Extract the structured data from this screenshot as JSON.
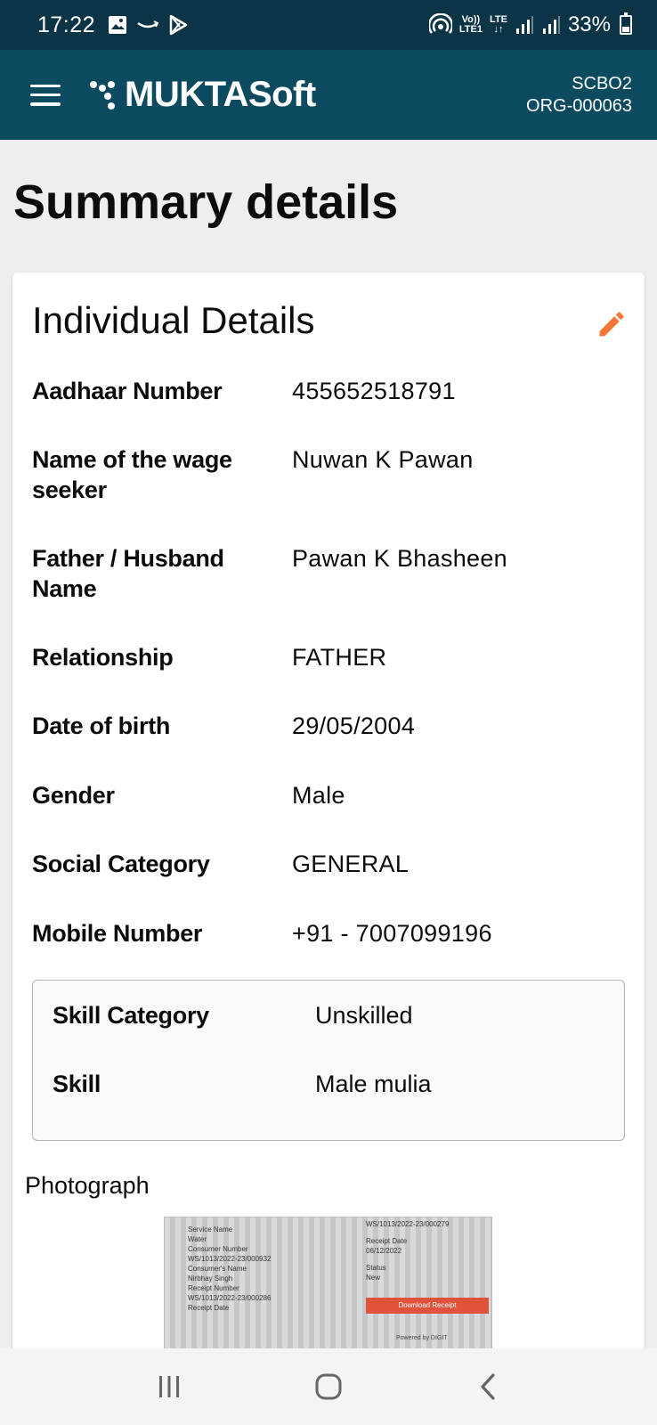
{
  "status_bar": {
    "time": "17:22",
    "battery": "33%",
    "volte": "Vo))",
    "lte1": "LTE1",
    "lte": "LTE",
    "icons": [
      "gallery-icon",
      "amazon-icon",
      "play-store-icon",
      "hotspot-icon",
      "signal-icon",
      "signal-icon",
      "battery-icon"
    ]
  },
  "header": {
    "brand": "MUKTASoft",
    "org_code": "SCBO2",
    "org_id": "ORG-000063",
    "colors": {
      "bar": "#0c4a60",
      "status": "#0c3447"
    }
  },
  "page": {
    "title": "Summary details"
  },
  "card": {
    "title": "Individual Details",
    "edit_color": "#f47738",
    "rows": [
      {
        "label": "Aadhaar Number",
        "value": "455652518791"
      },
      {
        "label": "Name of the wage seeker",
        "value": "Nuwan K Pawan"
      },
      {
        "label": "Father / Husband Name",
        "value": "Pawan K Bhasheen"
      },
      {
        "label": "Relationship",
        "value": "FATHER"
      },
      {
        "label": "Date of birth",
        "value": "29/05/2004"
      },
      {
        "label": "Gender",
        "value": "Male"
      },
      {
        "label": "Social Category",
        "value": "GENERAL"
      },
      {
        "label": "Mobile Number",
        "value": "+91 - 7007099196"
      }
    ],
    "skills": [
      {
        "label": "Skill Category",
        "value": "Unskilled"
      },
      {
        "label": "Skill",
        "value": "Male mulia"
      }
    ],
    "photo_label": "Photograph",
    "photo": {
      "left_lines": [
        "Service Name",
        "Water",
        "Consumer Number",
        "WS/1013/2022-23/000932",
        "Consumer's Name",
        "Nirbhay Singh",
        "Receipt Number",
        "WS/1013/2022-23/000286",
        "Receipt Date"
      ],
      "right_lines": [
        "WS/1013/2022-23/000279",
        "Receipt Date",
        "06/12/2022",
        "Status",
        "New"
      ],
      "button": "Download Receipt",
      "powered": "Powered by DIGIT"
    }
  },
  "nav": {
    "icons": [
      "recents-icon",
      "home-icon",
      "back-icon"
    ]
  }
}
